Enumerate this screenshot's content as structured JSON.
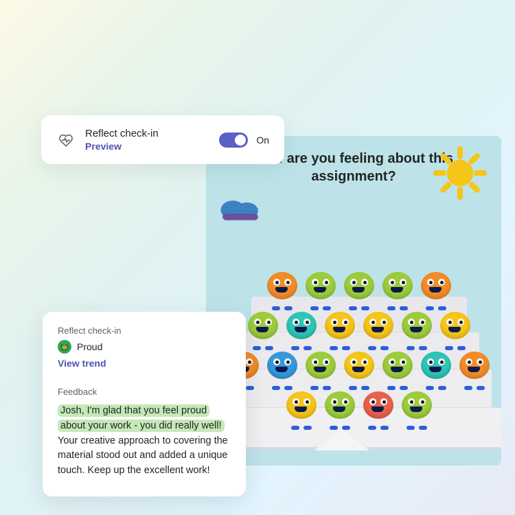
{
  "toggle_card": {
    "title": "Reflect check-in",
    "preview_label": "Preview",
    "state_label": "On"
  },
  "assignment": {
    "question": "How are you feeling about this assignment?"
  },
  "feedback_card": {
    "title": "Reflect check-in",
    "emotion": "Proud",
    "trend_link": "View trend",
    "feedback_heading": "Feedback",
    "feedback_highlight": "Josh, I'm glad that you feel proud about your work - you did really well!",
    "feedback_rest": " Your creative approach to covering the material stood out and added a unique touch. Keep up the excellent work!"
  }
}
